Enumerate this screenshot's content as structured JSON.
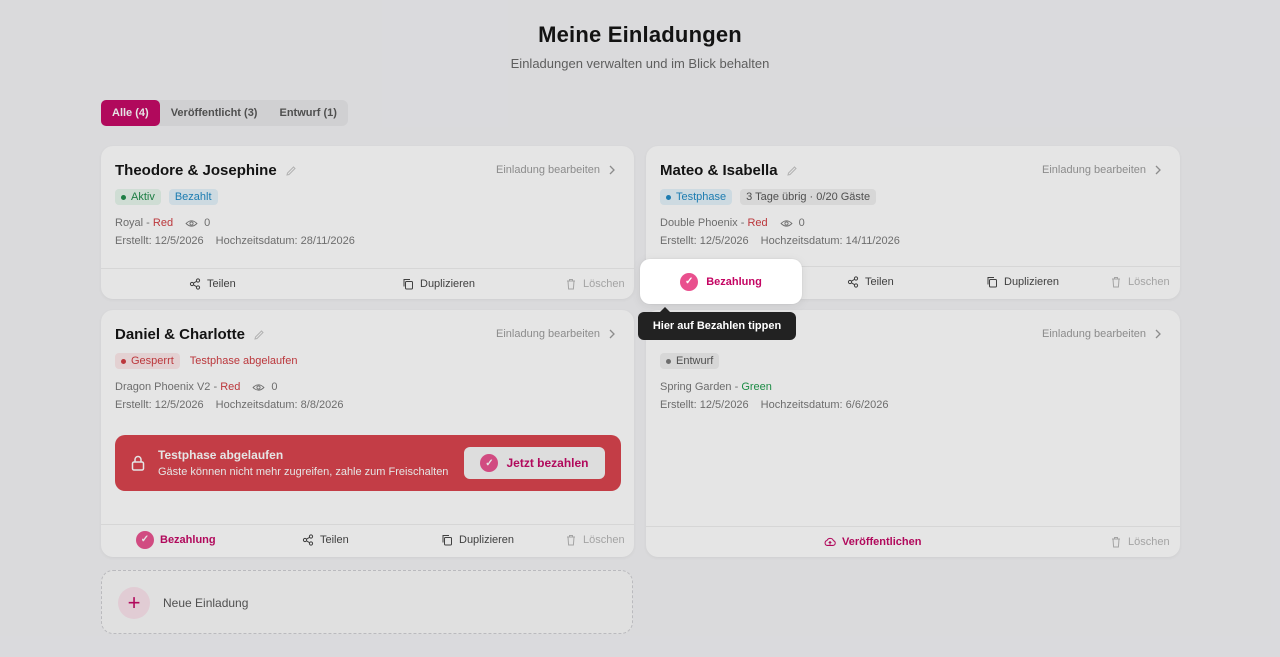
{
  "header": {
    "title": "Meine Einladungen",
    "subtitle": "Einladungen verwalten und im Blick behalten"
  },
  "tabs": [
    {
      "label": "Alle (4)",
      "active": true
    },
    {
      "label": "Veröffentlicht (3)",
      "active": false
    },
    {
      "label": "Entwurf (1)",
      "active": false
    }
  ],
  "common": {
    "edit_link": "Einladung bearbeiten",
    "share": "Teilen",
    "duplicate": "Duplizieren",
    "delete": "Löschen",
    "payment": "Bezahlung",
    "created_prefix": "Erstellt: ",
    "wedding_prefix": "Hochzeitsdatum: ",
    "dash": " - "
  },
  "cards": [
    {
      "name": "Theodore & Josephine",
      "badges": [
        "Aktiv",
        "Bezahlt"
      ],
      "template": "Royal",
      "color": "Red",
      "views": "0",
      "created": "12/5/2026",
      "wedding": "28/11/2026"
    },
    {
      "name": "Mateo & Isabella",
      "badges": [
        "Testphase",
        "3 Tage übrig · 0/20 Gäste"
      ],
      "template": "Double Phoenix",
      "color": "Red",
      "views": "0",
      "created": "12/5/2026",
      "wedding": "14/11/2026"
    },
    {
      "name": "Daniel & Charlotte",
      "badges": [
        "Gesperrt",
        "Testphase abgelaufen"
      ],
      "template": "Dragon Phoenix V2",
      "color": "Red",
      "views": "0",
      "created": "12/5/2026",
      "wedding": "8/8/2026",
      "alert": {
        "title": "Testphase abgelaufen",
        "text": "Gäste können nicht mehr zugreifen, zahle zum Freischalten",
        "button": "Jetzt bezahlen"
      }
    },
    {
      "name": "",
      "badges": [
        "Entwurf"
      ],
      "template": "Spring Garden",
      "color": "Green",
      "created": "12/5/2026",
      "wedding": "6/6/2026",
      "publish": "Veröffentlichen"
    }
  ],
  "new_invitation": "Neue Einladung",
  "tour": {
    "highlight_label": "Bezahlung",
    "tooltip": "Hier auf Bezahlen tippen"
  },
  "colors": {
    "accent": "#c40563",
    "alert": "#d9404a"
  }
}
